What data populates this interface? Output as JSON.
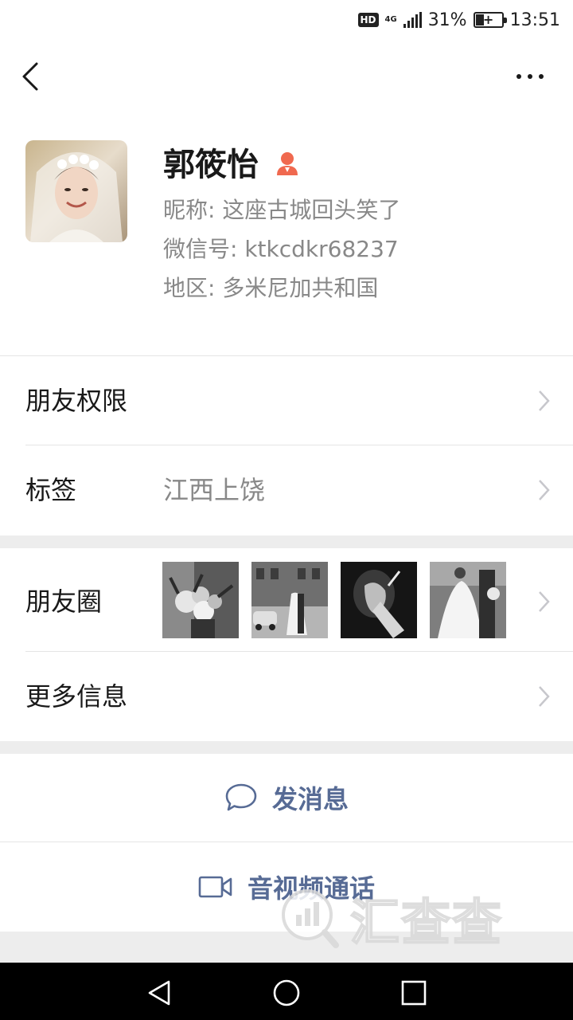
{
  "status_bar": {
    "hd": "HD",
    "network": "4G",
    "battery_percent": "31%",
    "time": "13:51"
  },
  "nav": {
    "back_icon": "chevron-left-icon",
    "more_icon": "more-dots-icon"
  },
  "profile": {
    "name": "郭筱怡",
    "gender_icon": "female-person-icon",
    "nickname": "昵称: 这座古城回头笑了",
    "wechat_id": "微信号: ktkcdkr68237",
    "region": "地区: 多米尼加共和国"
  },
  "cells": {
    "friend_permissions": "朋友权限",
    "tags_label": "标签",
    "tags_value": "江西上饶",
    "moments_label": "朋友圈",
    "more_info": "更多信息"
  },
  "actions": {
    "send_message": "发消息",
    "video_call": "音视频通话"
  },
  "watermark": {
    "text": "汇查查"
  },
  "colors": {
    "link": "#576b95",
    "gender_icon": "#f0694f",
    "background": "#ededed"
  }
}
